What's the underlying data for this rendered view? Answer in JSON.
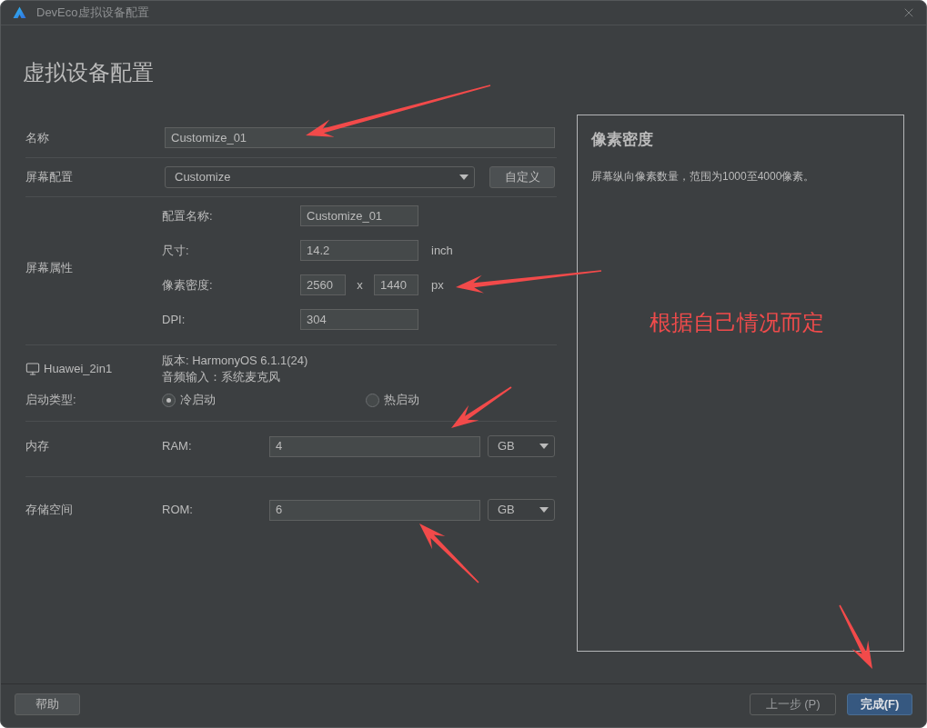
{
  "window": {
    "title": "DevEco虚拟设备配置"
  },
  "heading": "虚拟设备配置",
  "form": {
    "name": {
      "label": "名称",
      "value": "Customize_01"
    },
    "screen_config": {
      "label": "屏幕配置",
      "value": "Customize",
      "button": "自定义"
    },
    "screen_properties": {
      "label": "屏幕属性",
      "fields": [
        {
          "kind": "text",
          "label": "配置名称:",
          "value": "Customize_01"
        },
        {
          "kind": "unit",
          "label": "尺寸:",
          "value": "14.2",
          "unit": "inch"
        },
        {
          "kind": "pair",
          "label": "像素密度:",
          "value": "2560",
          "separator": "x",
          "value_2": "1440",
          "unit": "px"
        },
        {
          "kind": "text",
          "label": "DPI:",
          "value": "304"
        }
      ]
    },
    "device": {
      "name": "Huawei_2in1",
      "info": [
        "版本: HarmonyOS 6.1.1(24)",
        "音频输入：系统麦克风"
      ]
    },
    "boot_type": {
      "label": "启动类型:",
      "options": [
        {
          "label": "冷启动",
          "selected": true
        },
        {
          "label": "热启动",
          "selected": false
        }
      ]
    },
    "memory": {
      "label": "内存",
      "field_label": "RAM:",
      "value": "4",
      "unit": "GB"
    },
    "storage": {
      "label": "存储空间",
      "field_label": "ROM:",
      "value": "6",
      "unit": "GB"
    }
  },
  "help_panel": {
    "title": "像素密度",
    "text": "屏幕纵向像素数量，范围为1000至4000像素。"
  },
  "annotation": {
    "text": "根据自己情况而定"
  },
  "footer": {
    "help_button": "帮助",
    "buttons": [
      {
        "label": "上一步 (P)",
        "kind": "plain"
      },
      {
        "label": "完成(F)",
        "kind": "primary"
      }
    ]
  }
}
